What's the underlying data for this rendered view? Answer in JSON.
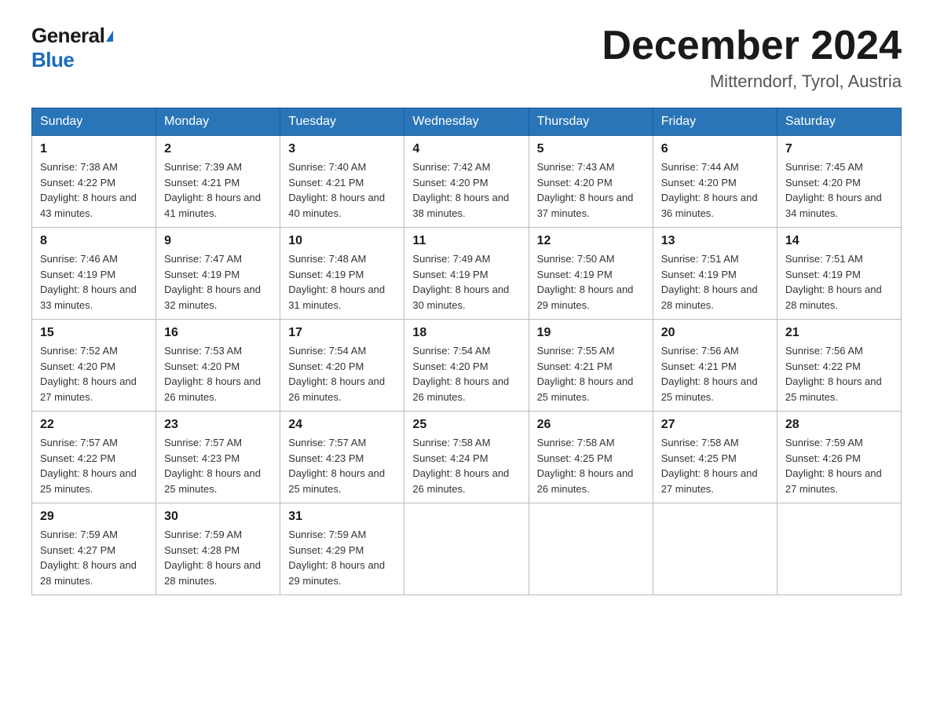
{
  "logo": {
    "general": "General",
    "blue": "Blue"
  },
  "title": "December 2024",
  "location": "Mitterndorf, Tyrol, Austria",
  "days_of_week": [
    "Sunday",
    "Monday",
    "Tuesday",
    "Wednesday",
    "Thursday",
    "Friday",
    "Saturday"
  ],
  "weeks": [
    [
      {
        "day": "1",
        "sunrise": "7:38 AM",
        "sunset": "4:22 PM",
        "daylight": "8 hours and 43 minutes."
      },
      {
        "day": "2",
        "sunrise": "7:39 AM",
        "sunset": "4:21 PM",
        "daylight": "8 hours and 41 minutes."
      },
      {
        "day": "3",
        "sunrise": "7:40 AM",
        "sunset": "4:21 PM",
        "daylight": "8 hours and 40 minutes."
      },
      {
        "day": "4",
        "sunrise": "7:42 AM",
        "sunset": "4:20 PM",
        "daylight": "8 hours and 38 minutes."
      },
      {
        "day": "5",
        "sunrise": "7:43 AM",
        "sunset": "4:20 PM",
        "daylight": "8 hours and 37 minutes."
      },
      {
        "day": "6",
        "sunrise": "7:44 AM",
        "sunset": "4:20 PM",
        "daylight": "8 hours and 36 minutes."
      },
      {
        "day": "7",
        "sunrise": "7:45 AM",
        "sunset": "4:20 PM",
        "daylight": "8 hours and 34 minutes."
      }
    ],
    [
      {
        "day": "8",
        "sunrise": "7:46 AM",
        "sunset": "4:19 PM",
        "daylight": "8 hours and 33 minutes."
      },
      {
        "day": "9",
        "sunrise": "7:47 AM",
        "sunset": "4:19 PM",
        "daylight": "8 hours and 32 minutes."
      },
      {
        "day": "10",
        "sunrise": "7:48 AM",
        "sunset": "4:19 PM",
        "daylight": "8 hours and 31 minutes."
      },
      {
        "day": "11",
        "sunrise": "7:49 AM",
        "sunset": "4:19 PM",
        "daylight": "8 hours and 30 minutes."
      },
      {
        "day": "12",
        "sunrise": "7:50 AM",
        "sunset": "4:19 PM",
        "daylight": "8 hours and 29 minutes."
      },
      {
        "day": "13",
        "sunrise": "7:51 AM",
        "sunset": "4:19 PM",
        "daylight": "8 hours and 28 minutes."
      },
      {
        "day": "14",
        "sunrise": "7:51 AM",
        "sunset": "4:19 PM",
        "daylight": "8 hours and 28 minutes."
      }
    ],
    [
      {
        "day": "15",
        "sunrise": "7:52 AM",
        "sunset": "4:20 PM",
        "daylight": "8 hours and 27 minutes."
      },
      {
        "day": "16",
        "sunrise": "7:53 AM",
        "sunset": "4:20 PM",
        "daylight": "8 hours and 26 minutes."
      },
      {
        "day": "17",
        "sunrise": "7:54 AM",
        "sunset": "4:20 PM",
        "daylight": "8 hours and 26 minutes."
      },
      {
        "day": "18",
        "sunrise": "7:54 AM",
        "sunset": "4:20 PM",
        "daylight": "8 hours and 26 minutes."
      },
      {
        "day": "19",
        "sunrise": "7:55 AM",
        "sunset": "4:21 PM",
        "daylight": "8 hours and 25 minutes."
      },
      {
        "day": "20",
        "sunrise": "7:56 AM",
        "sunset": "4:21 PM",
        "daylight": "8 hours and 25 minutes."
      },
      {
        "day": "21",
        "sunrise": "7:56 AM",
        "sunset": "4:22 PM",
        "daylight": "8 hours and 25 minutes."
      }
    ],
    [
      {
        "day": "22",
        "sunrise": "7:57 AM",
        "sunset": "4:22 PM",
        "daylight": "8 hours and 25 minutes."
      },
      {
        "day": "23",
        "sunrise": "7:57 AM",
        "sunset": "4:23 PM",
        "daylight": "8 hours and 25 minutes."
      },
      {
        "day": "24",
        "sunrise": "7:57 AM",
        "sunset": "4:23 PM",
        "daylight": "8 hours and 25 minutes."
      },
      {
        "day": "25",
        "sunrise": "7:58 AM",
        "sunset": "4:24 PM",
        "daylight": "8 hours and 26 minutes."
      },
      {
        "day": "26",
        "sunrise": "7:58 AM",
        "sunset": "4:25 PM",
        "daylight": "8 hours and 26 minutes."
      },
      {
        "day": "27",
        "sunrise": "7:58 AM",
        "sunset": "4:25 PM",
        "daylight": "8 hours and 27 minutes."
      },
      {
        "day": "28",
        "sunrise": "7:59 AM",
        "sunset": "4:26 PM",
        "daylight": "8 hours and 27 minutes."
      }
    ],
    [
      {
        "day": "29",
        "sunrise": "7:59 AM",
        "sunset": "4:27 PM",
        "daylight": "8 hours and 28 minutes."
      },
      {
        "day": "30",
        "sunrise": "7:59 AM",
        "sunset": "4:28 PM",
        "daylight": "8 hours and 28 minutes."
      },
      {
        "day": "31",
        "sunrise": "7:59 AM",
        "sunset": "4:29 PM",
        "daylight": "8 hours and 29 minutes."
      },
      null,
      null,
      null,
      null
    ]
  ]
}
